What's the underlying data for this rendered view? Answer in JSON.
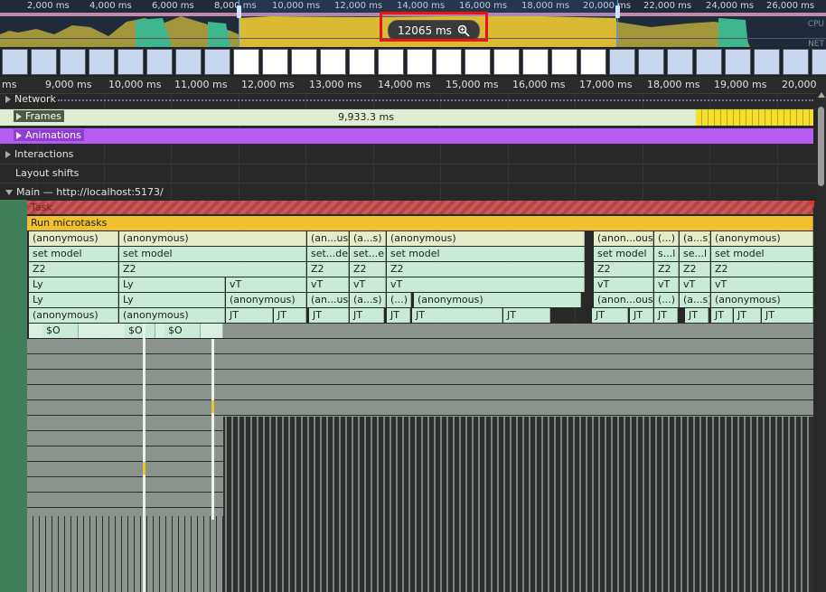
{
  "overview": {
    "ticks": [
      "2,000 ms",
      "4,000 ms",
      "6,000 ms",
      "8,000 ms",
      "10,000 ms",
      "12,000 ms",
      "14,000 ms",
      "16,000 ms",
      "18,000 ms",
      "20,000 ms",
      "22,000 ms",
      "24,000 ms",
      "26,000 ms"
    ],
    "cpu_label": "CPU",
    "net_label": "NET",
    "zoom_duration": "12065 ms",
    "zoom_icon": "zoom-in-icon"
  },
  "ruler": {
    "ticks": [
      "ms",
      "9,000 ms",
      "10,000 ms",
      "11,000 ms",
      "12,000 ms",
      "13,000 ms",
      "14,000 ms",
      "15,000 ms",
      "16,000 ms",
      "17,000 ms",
      "18,000 ms",
      "19,000 ms",
      "20,000"
    ]
  },
  "tracks": {
    "network": "Network",
    "frames": "Frames",
    "frames_duration": "9,933.3 ms",
    "animations": "Animations",
    "interactions": "Interactions",
    "layout_shifts": "Layout shifts",
    "main": "Main — http://localhost:5173/"
  },
  "flame": {
    "task": "Task",
    "microtasks": "Run microtasks",
    "row_anon": [
      "(anonymous)",
      "(anonymous)",
      "(an...us)",
      "(a...s)",
      "(anonymous)",
      "(anon...ous)",
      "(...)",
      "(a...s)",
      "(anonymous)"
    ],
    "row_model": [
      "set model",
      "set model",
      "set...del",
      "set...el",
      "set model",
      "set model",
      "s...l",
      "se...l",
      "set model"
    ],
    "row_z2": [
      "Z2",
      "Z2",
      "Z2",
      "Z2",
      "Z2",
      "Z2",
      "Z2",
      "Z2",
      "Z2"
    ],
    "row_ly": [
      "Ly",
      "Ly",
      "vT",
      "vT",
      "vT",
      "vT",
      "vT",
      "vT",
      "vT",
      "vT"
    ],
    "row_ly2": [
      "Ly",
      "Ly",
      "(anonymous)",
      "(an...us)",
      "(a...s)",
      "(...)",
      "(anonymous)",
      "(anon...ous)",
      "(...)",
      "(a...s)",
      "(anonymous)"
    ],
    "row_jt": [
      "(anonymous)",
      "(anonymous)",
      "JT",
      "JT",
      "JT",
      "JT",
      "JT",
      "JT",
      "JT",
      "JT",
      "JT",
      "JT",
      "JT",
      "JT",
      "JT",
      "JT"
    ],
    "row_so": [
      "$O",
      "$O",
      "$O"
    ]
  },
  "colors": {
    "task": "#c95858",
    "microtasks": "#f0c12c",
    "anon": "#e6ecc7",
    "model": "#c9ead4",
    "animations": "#b65cf3",
    "frames": "#dfeed0"
  }
}
